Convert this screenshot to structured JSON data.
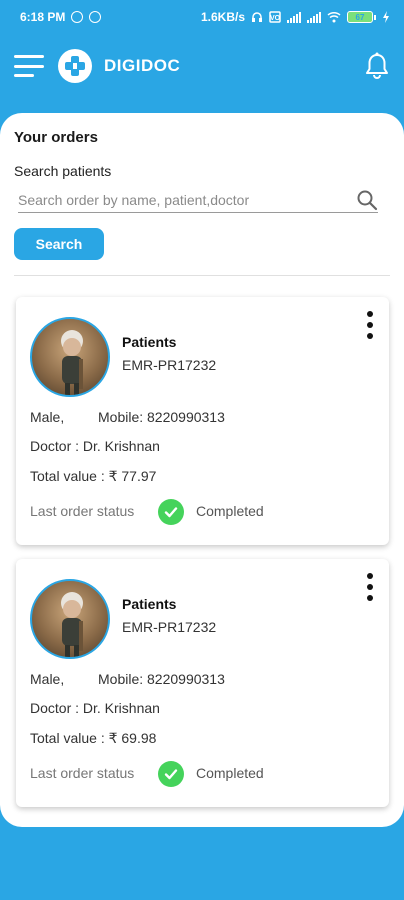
{
  "status_bar": {
    "time": "6:18 PM",
    "speed": "1.6KB/s",
    "battery": "67"
  },
  "header": {
    "title": "DIGIDOC"
  },
  "orders_section": {
    "title": "Your orders",
    "search_label": "Search patients",
    "search_placeholder": "Search order by name, patient,doctor",
    "search_value": "",
    "search_button": "Search"
  },
  "orders": [
    {
      "name_label": "Patients",
      "id": "EMR-PR17232",
      "gender": "Male,",
      "mobile": "Mobile: 8220990313",
      "doctor": "Doctor : Dr. Krishnan",
      "total": "Total value : ₹ 77.97",
      "status_label": "Last order status",
      "status": "Completed"
    },
    {
      "name_label": "Patients",
      "id": "EMR-PR17232",
      "gender": "Male,",
      "mobile": "Mobile: 8220990313",
      "doctor": "Doctor : Dr. Krishnan",
      "total": "Total value : ₹ 69.98",
      "status_label": "Last order status",
      "status": "Completed"
    }
  ],
  "colors": {
    "primary": "#2aa6e4",
    "status_ok": "#45d35b"
  },
  "icons": [
    "menu-icon",
    "logo-icon",
    "bell-icon",
    "search-icon",
    "more-vert-icon",
    "check-circle-icon"
  ]
}
